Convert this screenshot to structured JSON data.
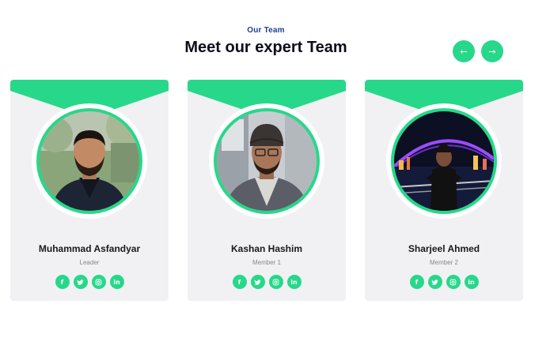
{
  "section": {
    "eyebrow": "Our Team",
    "title": "Meet our expert Team"
  },
  "slider": {
    "prev_icon": "←",
    "next_icon": "→"
  },
  "accent_color": "#27d88a",
  "members": [
    {
      "name": "Muhammad Asfandyar",
      "role": "Leader",
      "photo": "portrait-outdoor"
    },
    {
      "name": "Kashan Hashim",
      "role": "Member 1",
      "photo": "portrait-indoor"
    },
    {
      "name": "Sharjeel Ahmed",
      "role": "Member 2",
      "photo": "portrait-night-bridge"
    }
  ],
  "social_icons": {
    "facebook": "f",
    "twitter": "🐦",
    "instagram": "◎",
    "linkedin": "in"
  }
}
